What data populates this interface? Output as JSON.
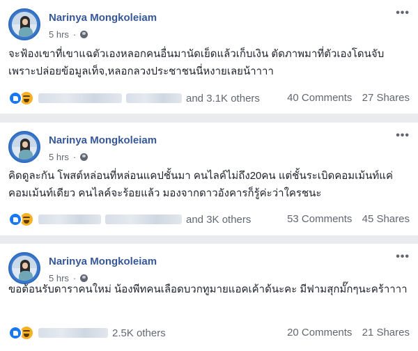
{
  "posts": [
    {
      "author": "Narinya Mongkoleiam",
      "time": "5 hrs",
      "text": "จะฟ้องเขาที่เขาแฉตัวเองหลอกคนอื่นมานัดเย็ดแล้วเก็บเงิน ตัดภาพมาที่ตัวเองโดนจับ เพราะปล่อยข้อมูลเท็จ,หลอกลวงประชาชนนี่หงายเลยน้าาาา",
      "others": "and 3.1K others",
      "comments": "40 Comments",
      "shares": "27 Shares"
    },
    {
      "author": "Narinya Mongkoleiam",
      "time": "5 hrs",
      "text": "คิดดูละกัน โพสต์หล่อนที่หล่อนแคปชั้นมา คนไลค์ไม่ถึง20คน แต่ชั้นระเบิดคอมเม้นท์แค่คอมเม้นท์เดียว คนไลค์จะร้อยแล้ว มองจากดาวอังคารก็รู้ค่ะว่าใครชนะ",
      "others": "and 3K others",
      "comments": "53 Comments",
      "shares": "45 Shares"
    },
    {
      "author": "Narinya Mongkoleiam",
      "time": "5 hrs",
      "text": "ขอต้อนรับดาราคนใหม่ น้องพีทคนเลือดบวกทูมายแอคเค้าด้นะคะ มีฟามสุกมั๊กๆนะคร้าาาา",
      "others": "2.5K others",
      "comments": "20 Comments",
      "shares": "21 Shares"
    }
  ],
  "icons": [
    "avatar",
    "globe-icon",
    "more-icon",
    "like-icon",
    "haha-icon"
  ],
  "colors": {
    "name": "#365899",
    "like": "#1877f2",
    "haha": "#f7b125",
    "background": "#e9ebee"
  }
}
